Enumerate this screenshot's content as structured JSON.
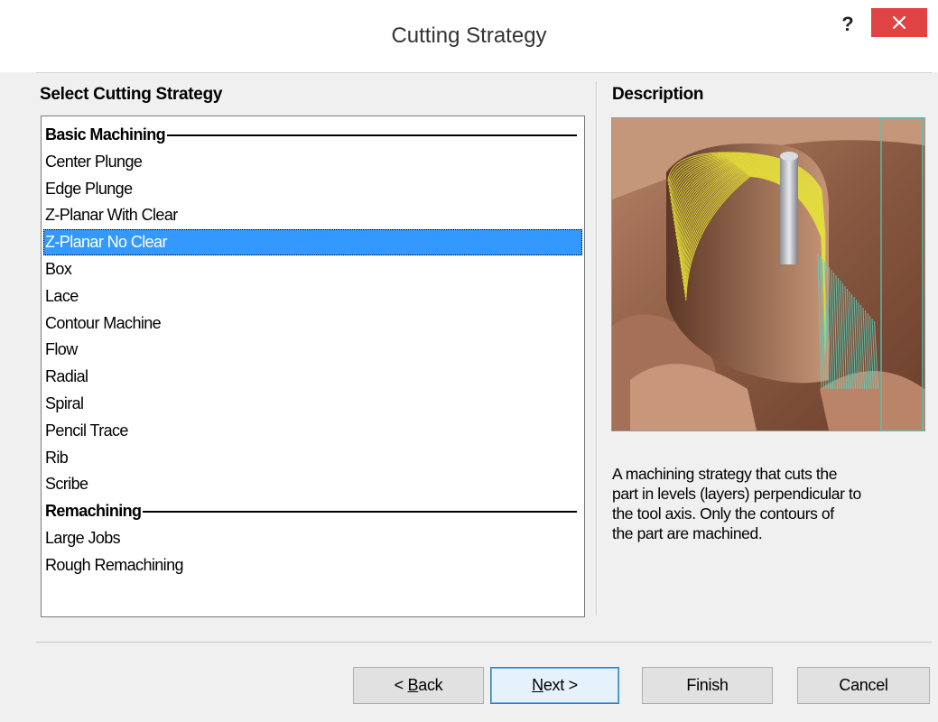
{
  "window": {
    "title": "Cutting Strategy",
    "help_label": "?"
  },
  "left": {
    "heading": "Select Cutting Strategy",
    "items": [
      {
        "label": "Basic Machining",
        "type": "header"
      },
      {
        "label": "Center Plunge",
        "type": "item"
      },
      {
        "label": "Edge Plunge",
        "type": "item"
      },
      {
        "label": "Z-Planar With Clear",
        "type": "item"
      },
      {
        "label": "Z-Planar No Clear",
        "type": "item",
        "selected": true
      },
      {
        "label": "Box",
        "type": "item"
      },
      {
        "label": "Lace",
        "type": "item"
      },
      {
        "label": "Contour Machine",
        "type": "item"
      },
      {
        "label": "Flow",
        "type": "item"
      },
      {
        "label": "Radial",
        "type": "item"
      },
      {
        "label": "Spiral",
        "type": "item"
      },
      {
        "label": "Pencil Trace",
        "type": "item"
      },
      {
        "label": "Rib",
        "type": "item"
      },
      {
        "label": "Scribe",
        "type": "item"
      },
      {
        "label": "Remachining",
        "type": "header"
      },
      {
        "label": "Large Jobs",
        "type": "item"
      },
      {
        "label": "Rough Remachining",
        "type": "item"
      }
    ]
  },
  "right": {
    "heading": "Description",
    "description_lines": [
      "A machining strategy that cuts the",
      "part in levels (layers) perpendicular to",
      "the tool axis.  Only the contours of",
      "the part are machined."
    ]
  },
  "buttons": {
    "back_prefix": "< ",
    "back_accel": "B",
    "back_rest": "ack",
    "next_accel": "N",
    "next_rest": "ext >",
    "finish": "Finish",
    "cancel": "Cancel"
  },
  "colors": {
    "selection": "#3399ff",
    "close_button": "#e04343"
  }
}
